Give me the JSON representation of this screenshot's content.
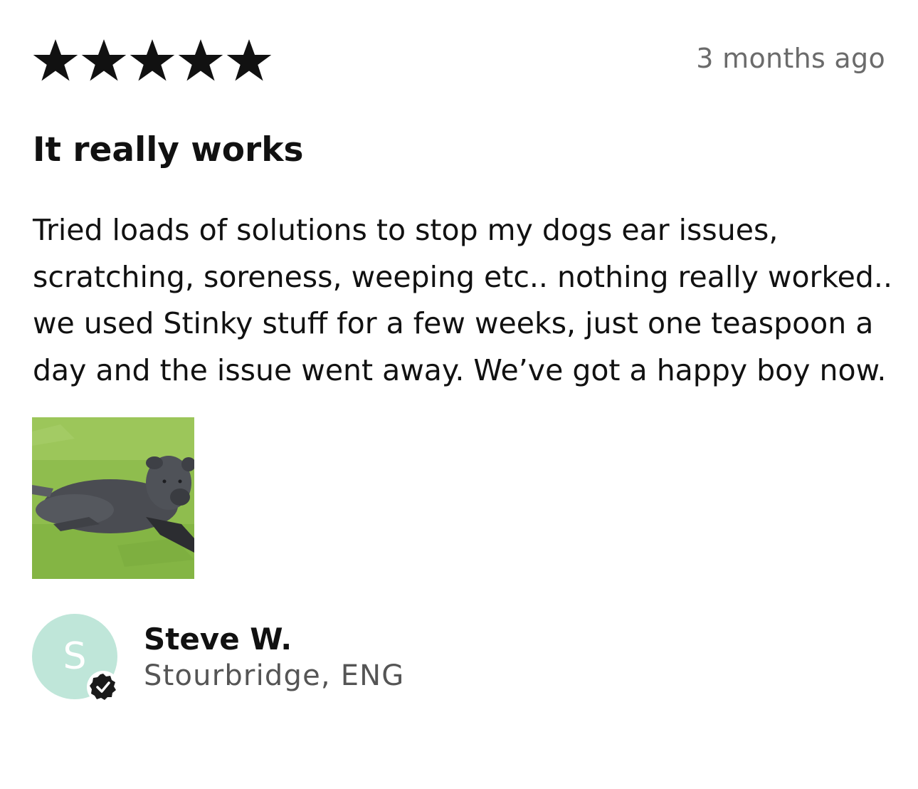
{
  "review": {
    "rating": 5,
    "rating_max": 5,
    "timestamp": "3 months ago",
    "title": "It really works",
    "body_lines": [
      "Tried loads of solutions to stop my dogs ear issues,",
      "scratching, soreness, weeping etc.. nothing really worked..",
      "we used Stinky stuff for a few weeks, just one teaspoon a",
      "day and the issue went away. We’ve got a happy boy now."
    ],
    "photo_icon": "dog-photo",
    "author": {
      "initial": "S",
      "name": "Steve W.",
      "location": "Stourbridge, ENG",
      "verified_icon": "verified-check-icon"
    }
  },
  "colors": {
    "star": "#111111",
    "timestamp": "#6b6b6b",
    "avatar_bg": "#bfe6d9",
    "location": "#555555",
    "badge": "#1a1a1a"
  }
}
